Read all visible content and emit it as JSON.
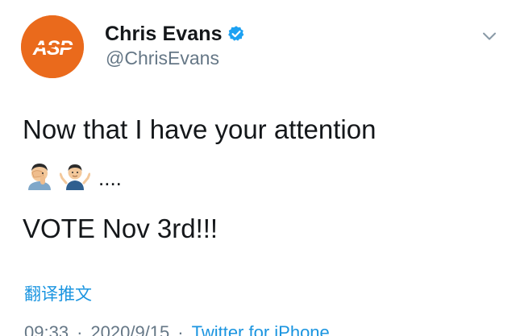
{
  "tweet": {
    "avatar_label": "ASP",
    "brand_color": "#EA6A1C",
    "verified_color": "#1DA1F2",
    "link_color": "#1B95E0",
    "display_name": "Chris Evans",
    "handle": "@ChrisEvans",
    "text_line_1": "Now that I have your attention",
    "emojis": [
      "face-palm-emoji",
      "shrug-emoji"
    ],
    "ellipsis": "....",
    "text_line_3": "VOTE Nov 3rd!!!",
    "translate_label": "翻译推文",
    "time": "09:33",
    "separator": "·",
    "date": "2020/9/15",
    "source": "Twitter for iPhone"
  }
}
